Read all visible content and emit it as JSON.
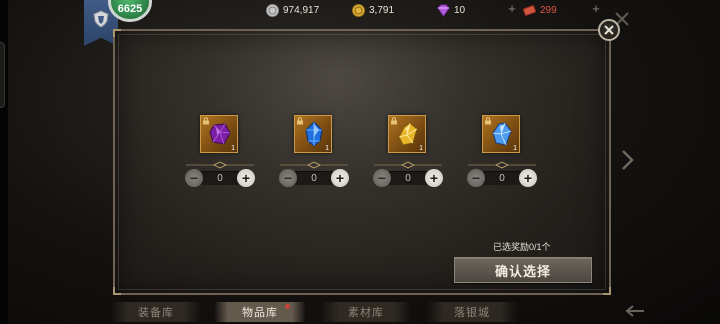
{
  "header": {
    "level_badge": "6625",
    "currencies": [
      {
        "name": "silver-coin",
        "value": "974,917"
      },
      {
        "name": "gold-coin",
        "value": "3,791"
      },
      {
        "name": "diamond",
        "value": "10"
      },
      {
        "name": "ticket",
        "value": "299",
        "color": "#e05445"
      }
    ]
  },
  "rewards": [
    {
      "gem": "purple-gem-icon",
      "qty": "1",
      "count": "0"
    },
    {
      "gem": "blue-crystal-icon",
      "qty": "1",
      "count": "0"
    },
    {
      "gem": "yellow-crystal-icon",
      "qty": "1",
      "count": "0"
    },
    {
      "gem": "light-blue-crystal-icon",
      "qty": "1",
      "count": "0"
    }
  ],
  "selection": {
    "prefix": "已选奖励",
    "selected": "0",
    "suffix": "/1个"
  },
  "confirm_label": "确认选择",
  "tabs": [
    {
      "label": "装备库"
    },
    {
      "label": "物品库",
      "active": true
    },
    {
      "label": "素材库"
    },
    {
      "label": "落银城"
    }
  ]
}
